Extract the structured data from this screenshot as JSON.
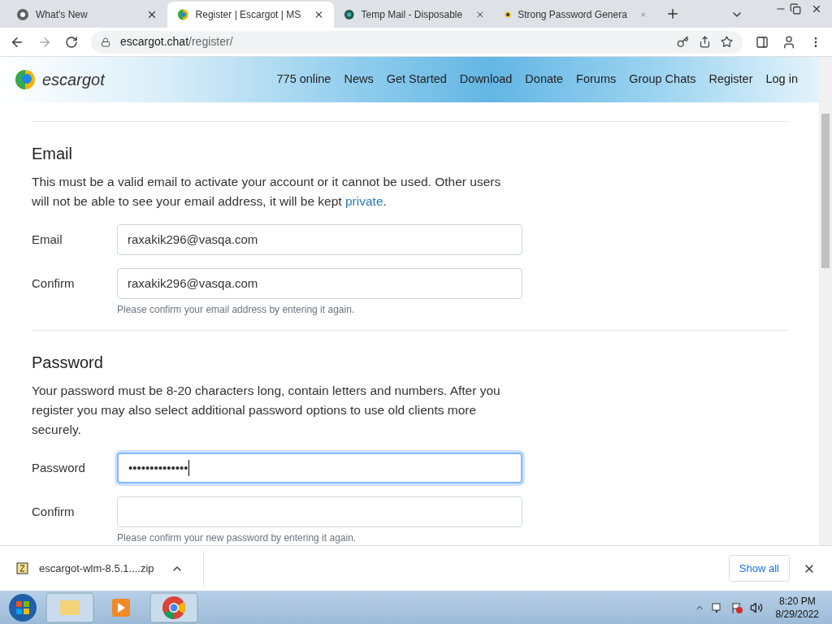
{
  "tabs": [
    {
      "title": "What's New",
      "selected": false
    },
    {
      "title": "Register | Escargot | MS",
      "selected": true
    },
    {
      "title": "Temp Mail - Disposable",
      "selected": false
    },
    {
      "title": "Strong Password Genera",
      "selected": false
    }
  ],
  "address": {
    "host": "escargot.chat",
    "path": "/register/"
  },
  "site": {
    "logo": "escargot",
    "nav": [
      "775 online",
      "News",
      "Get Started",
      "Download",
      "Donate",
      "Forums",
      "Group Chats",
      "Register",
      "Log in"
    ]
  },
  "sections": [
    {
      "title": "Email",
      "text": "This must be a valid email to activate your account or it cannot be used. Other users will not be able to see your email address, it will be kept ",
      "link": "private",
      "after": ".",
      "fields": [
        {
          "label": "Email",
          "value": "raxakik296@vasqa.com",
          "focused": false
        },
        {
          "label": "Confirm",
          "value": "raxakik296@vasqa.com",
          "focused": false,
          "hint": "Please confirm your email address by entering it again."
        }
      ]
    },
    {
      "title": "Password",
      "text": "Your password must be 8-20 characters long, contain letters and numbers. After you register you may also select additional password options to use old clients more securely.",
      "fields": [
        {
          "label": "Password",
          "value": "••••••••••••••",
          "focused": true
        },
        {
          "label": "Confirm",
          "focused": false,
          "hint": "Please confirm your new password by entering it again."
        }
      ]
    }
  ],
  "download": {
    "file": "escargot-wlm-8.5.1....zip",
    "show_all": "Show all"
  },
  "taskbar": {
    "time": "8:20 PM",
    "date": "8/29/2022"
  }
}
